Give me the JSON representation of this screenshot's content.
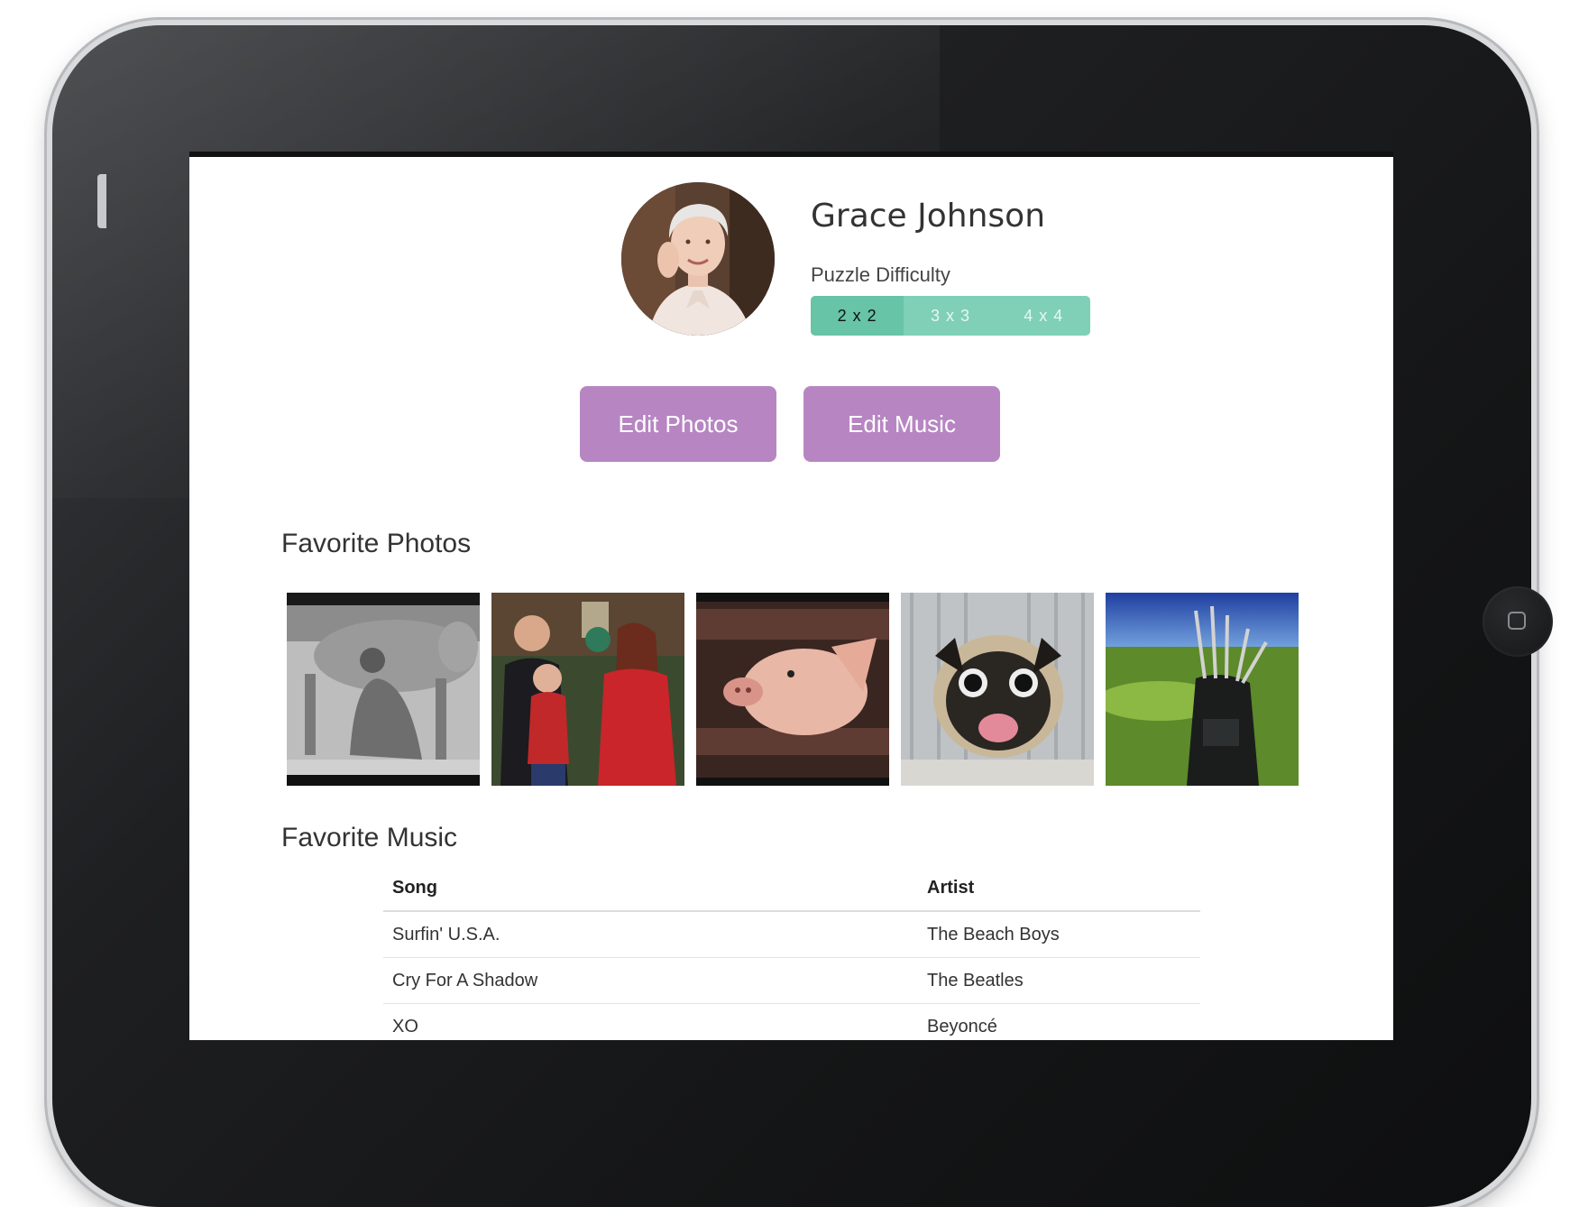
{
  "profile": {
    "name": "Grace Johnson",
    "difficulty_label": "Puzzle Difficulty",
    "difficulty_options": [
      "2 x 2",
      "3 x 3",
      "4 x 4"
    ],
    "difficulty_selected": "2 x 2"
  },
  "actions": {
    "edit_photos": "Edit Photos",
    "edit_music": "Edit Music"
  },
  "photos": {
    "title": "Favorite Photos",
    "items": [
      {
        "subject": "woman milking cow (black and white)"
      },
      {
        "subject": "family portrait"
      },
      {
        "subject": "pig"
      },
      {
        "subject": "pug dog"
      },
      {
        "subject": "golf bag on course"
      }
    ]
  },
  "music": {
    "title": "Favorite Music",
    "columns": {
      "song": "Song",
      "artist": "Artist"
    },
    "rows": [
      {
        "song": "Surfin' U.S.A.",
        "artist": "The Beach Boys"
      },
      {
        "song": "Cry For A Shadow",
        "artist": "The Beatles"
      },
      {
        "song": "XO",
        "artist": "Beyoncé"
      }
    ]
  },
  "colors": {
    "accent_purple": "#b786c2",
    "segment_teal": "#7fd0b6",
    "segment_active": "#67c4a6"
  }
}
